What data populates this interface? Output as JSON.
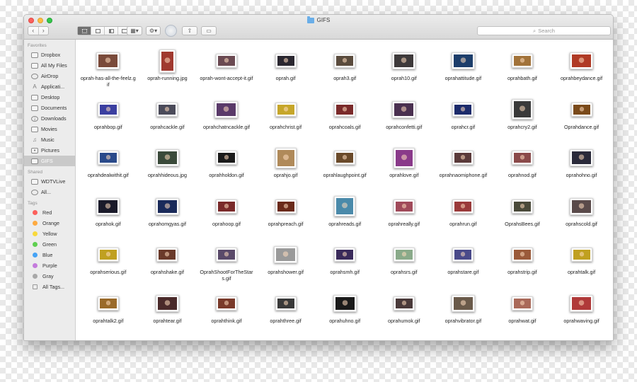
{
  "window": {
    "title": "GIFS",
    "search_placeholder": "Search",
    "nav_back": "‹",
    "nav_forward": "›",
    "arrange_icon": "grid-arrange-icon",
    "action_icon": "gear-icon",
    "colors": {
      "titlebar": "#dcdcdc",
      "sidebar": "#ececec",
      "folder": "#6aaee8"
    }
  },
  "sidebar": {
    "favorites_header": "Favorites",
    "favorites": [
      {
        "label": "Dropbox",
        "icon": "dropbox-folder-icon"
      },
      {
        "label": "All My Files",
        "icon": "all-files-icon"
      },
      {
        "label": "AirDrop",
        "icon": "airdrop-icon"
      },
      {
        "label": "Applicati...",
        "icon": "applications-icon"
      },
      {
        "label": "Desktop",
        "icon": "desktop-icon"
      },
      {
        "label": "Documents",
        "icon": "documents-icon"
      },
      {
        "label": "Downloads",
        "icon": "downloads-icon"
      },
      {
        "label": "Movies",
        "icon": "movies-icon"
      },
      {
        "label": "Music",
        "icon": "music-icon"
      },
      {
        "label": "Pictures",
        "icon": "pictures-icon"
      },
      {
        "label": "GIFS",
        "icon": "folder-icon"
      }
    ],
    "shared_header": "Shared",
    "shared": [
      {
        "label": "WDTVLive",
        "icon": "monitor-icon"
      },
      {
        "label": "All...",
        "icon": "network-globe-icon"
      }
    ],
    "tags_header": "Tags",
    "tags": [
      {
        "label": "Red",
        "color": "#fc605c"
      },
      {
        "label": "Orange",
        "color": "#fdaa40"
      },
      {
        "label": "Yellow",
        "color": "#f8d93c"
      },
      {
        "label": "Green",
        "color": "#5fcf50"
      },
      {
        "label": "Blue",
        "color": "#46a3f5"
      },
      {
        "label": "Purple",
        "color": "#c47bdc"
      },
      {
        "label": "Gray",
        "color": "#a8a8a8"
      },
      {
        "label": "All Tags...",
        "color": ""
      }
    ]
  },
  "files": [
    {
      "name": "oprah-has-all-the-feelz.gif",
      "shape": "normal",
      "color": "#7a4a3a"
    },
    {
      "name": "oprah-running.jpg",
      "shape": "tall",
      "color": "#a0392f"
    },
    {
      "name": "oprah-wont-accept-it.gif",
      "shape": "wide",
      "color": "#6b4a52"
    },
    {
      "name": "oprah.gif",
      "shape": "wide",
      "color": "#2a2730"
    },
    {
      "name": "oprah3.gif",
      "shape": "wide",
      "color": "#5a4b3d"
    },
    {
      "name": "oprah10.gif",
      "shape": "normal",
      "color": "#3e3a3b"
    },
    {
      "name": "oprahattitude.gif",
      "shape": "normal",
      "color": "#1d3e6b"
    },
    {
      "name": "oprahbath.gif",
      "shape": "wide",
      "color": "#a2733a"
    },
    {
      "name": "oprahbeydance.gif",
      "shape": "normal",
      "color": "#b03a25"
    },
    {
      "name": "oprahbop.gif",
      "shape": "wide",
      "color": "#3b3fa0"
    },
    {
      "name": "oprahcackle.gif",
      "shape": "wide",
      "color": "#4b4b5a"
    },
    {
      "name": "oprahchatncackle.gif",
      "shape": "normal",
      "color": "#5a3a6a"
    },
    {
      "name": "oprahchrist.gif",
      "shape": "wide",
      "color": "#c6a62a"
    },
    {
      "name": "oprahcoals.gif",
      "shape": "wide",
      "color": "#7a2a2a"
    },
    {
      "name": "oprahconfetti.gif",
      "shape": "normal",
      "color": "#4a3050"
    },
    {
      "name": "oprahcr.gif",
      "shape": "wide",
      "color": "#1c2b6b"
    },
    {
      "name": "oprahcry2.gif",
      "shape": "square",
      "color": "#3a3a3a"
    },
    {
      "name": "Oprahdance.gif",
      "shape": "wide",
      "color": "#7a4a1a"
    },
    {
      "name": "oprahdealwithit.gif",
      "shape": "wide",
      "color": "#2a4a8a"
    },
    {
      "name": "oprahhideous.jpg",
      "shape": "normal",
      "color": "#3a4a3a"
    },
    {
      "name": "oprahholdon.gif",
      "shape": "wide",
      "color": "#1a1a1a"
    },
    {
      "name": "oprahjo.gif",
      "shape": "square",
      "color": "#b08a5a"
    },
    {
      "name": "oprahlaughpoint.gif",
      "shape": "wide",
      "color": "#6a4a2a"
    },
    {
      "name": "oprahlove.gif",
      "shape": "square",
      "color": "#8a3a8a"
    },
    {
      "name": "oprahnaomiphone.gif",
      "shape": "wide",
      "color": "#5a3a3a"
    },
    {
      "name": "oprahnod.gif",
      "shape": "wide",
      "color": "#8a4a4a"
    },
    {
      "name": "oprahohno.gif",
      "shape": "normal",
      "color": "#2a2a3a"
    },
    {
      "name": "oprahok.gif",
      "shape": "normal",
      "color": "#1a1a2a"
    },
    {
      "name": "oprahomgyas.gif",
      "shape": "normal",
      "color": "#1a2a5a"
    },
    {
      "name": "oprahoop.gif",
      "shape": "wide",
      "color": "#7a2a2a"
    },
    {
      "name": "oprahpreach.gif",
      "shape": "wide",
      "color": "#6a2a1a"
    },
    {
      "name": "oprahreads.gif",
      "shape": "square",
      "color": "#4a8aaa"
    },
    {
      "name": "oprahreally.gif",
      "shape": "wide",
      "color": "#a04a5a"
    },
    {
      "name": "oprahrun.gif",
      "shape": "wide",
      "color": "#9a3a3a"
    },
    {
      "name": "OprahsBees.gif",
      "shape": "wide",
      "color": "#4a4a3a"
    },
    {
      "name": "oprahscold.gif",
      "shape": "normal",
      "color": "#5a4a4a"
    },
    {
      "name": "oprahserious.gif",
      "shape": "wide",
      "color": "#c0a020"
    },
    {
      "name": "oprahshake.gif",
      "shape": "wide",
      "color": "#6a3a2a"
    },
    {
      "name": "OprahShootForTheStars.gif",
      "shape": "wide",
      "color": "#5a4a6a"
    },
    {
      "name": "oprahshower.gif",
      "shape": "normal",
      "color": "#9a9a9a"
    },
    {
      "name": "oprahsmh.gif",
      "shape": "wide",
      "color": "#3a2a5a"
    },
    {
      "name": "oprahsrs.gif",
      "shape": "wide",
      "color": "#8aaa8a"
    },
    {
      "name": "oprahstare.gif",
      "shape": "wide",
      "color": "#4a4a8a"
    },
    {
      "name": "oprahstrip.gif",
      "shape": "wide",
      "color": "#9a5a3a"
    },
    {
      "name": "oprahtalk.gif",
      "shape": "wide",
      "color": "#c0a020"
    },
    {
      "name": "oprahtalk2.gif",
      "shape": "wide",
      "color": "#9a6a2a"
    },
    {
      "name": "oprahtear.gif",
      "shape": "normal",
      "color": "#4a2a2a"
    },
    {
      "name": "oprahthink.gif",
      "shape": "wide",
      "color": "#7a3a2a"
    },
    {
      "name": "oprahthree.gif",
      "shape": "wide",
      "color": "#3a3a3a"
    },
    {
      "name": "oprahuhno.gif",
      "shape": "normal",
      "color": "#1a1a1a"
    },
    {
      "name": "oprahumok.gif",
      "shape": "wide",
      "color": "#4a3a3a"
    },
    {
      "name": "oprahvibrator.gif",
      "shape": "normal",
      "color": "#6a5a4a"
    },
    {
      "name": "oprahwat.gif",
      "shape": "wide",
      "color": "#aa6a5a"
    },
    {
      "name": "oprahwaving.gif",
      "shape": "normal",
      "color": "#b03a3a"
    },
    {
      "name": "",
      "shape": "wide",
      "color": "#5a5a5a"
    },
    {
      "name": "",
      "shape": "wide",
      "color": "#eeeeee"
    },
    {
      "name": "",
      "shape": "wide",
      "color": "#7a3a2a"
    },
    {
      "name": "",
      "shape": "wide",
      "color": "#eeeeee"
    },
    {
      "name": "",
      "shape": "wide",
      "color": "#eeeeee"
    },
    {
      "name": "",
      "shape": "wide",
      "color": "#eeeeee"
    },
    {
      "name": "",
      "shape": "normal",
      "color": "#2a2a2a"
    }
  ]
}
